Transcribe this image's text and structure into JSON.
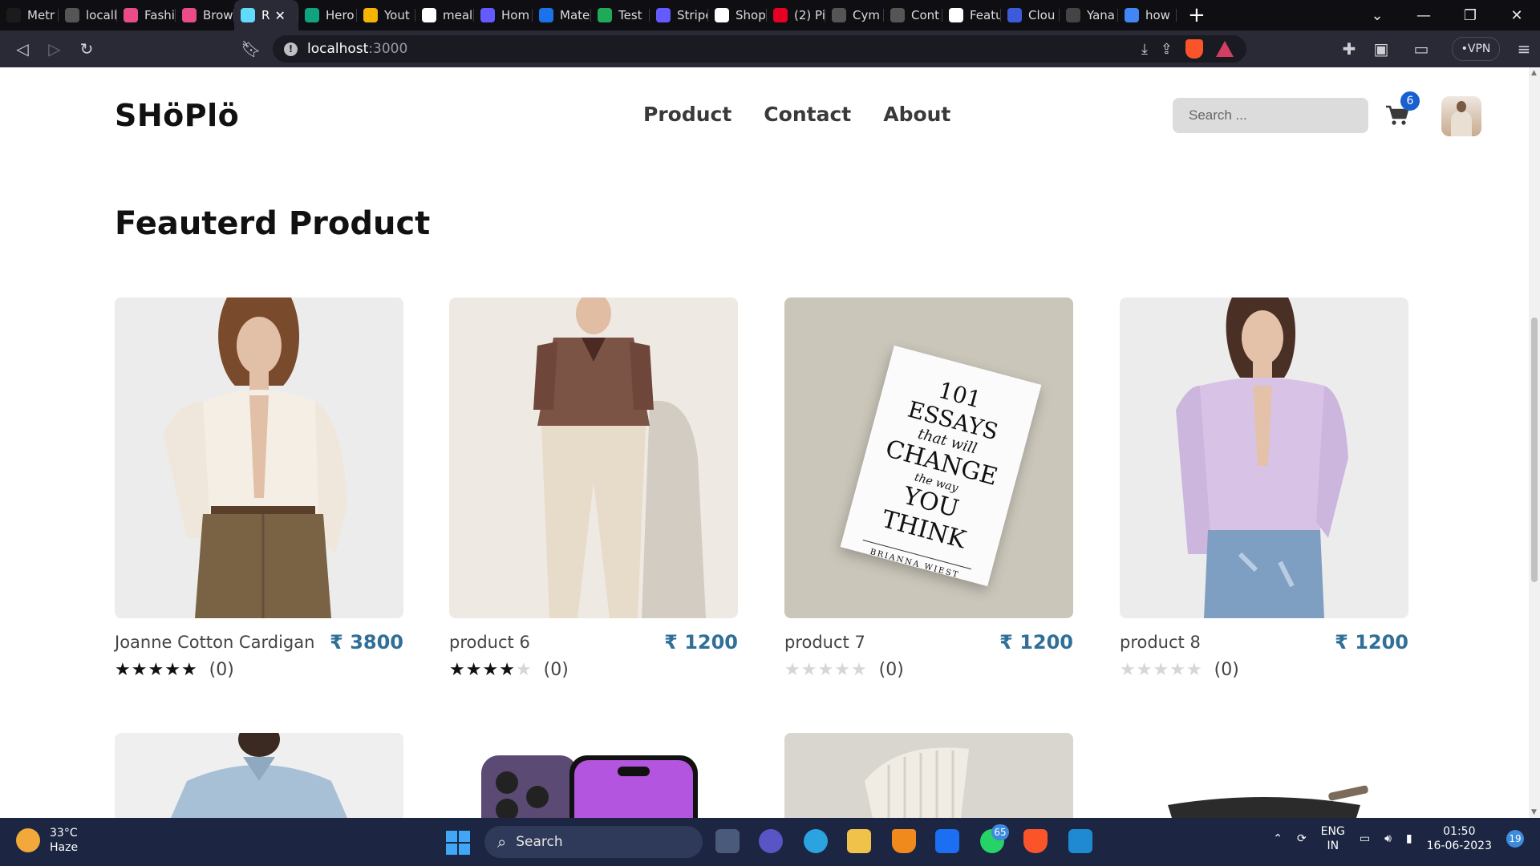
{
  "browser": {
    "tabs": [
      {
        "label": "Metr",
        "color": "#1b1b1b"
      },
      {
        "label": "locall",
        "color": "#555555"
      },
      {
        "label": "Fashi",
        "color": "#ea4c89"
      },
      {
        "label": "Brow",
        "color": "#ea4c89"
      },
      {
        "label": "R",
        "color": "#61dafb"
      },
      {
        "label": "Hero",
        "color": "#10a37f"
      },
      {
        "label": "Yout",
        "color": "#f6b400"
      },
      {
        "label": "meal",
        "color": "#ffffff"
      },
      {
        "label": "Hom",
        "color": "#635bff"
      },
      {
        "label": "Mate",
        "color": "#1a73e8"
      },
      {
        "label": "Test",
        "color": "#1faa59"
      },
      {
        "label": "Stripe",
        "color": "#635bff"
      },
      {
        "label": "Shop",
        "color": "#ffffff"
      },
      {
        "label": "(2) Pi",
        "color": "#e60023"
      },
      {
        "label": "Cym",
        "color": "#555555"
      },
      {
        "label": "Cont",
        "color": "#555555"
      },
      {
        "label": "Featu",
        "color": "#ffffff"
      },
      {
        "label": "Clou",
        "color": "#3b5bdb"
      },
      {
        "label": "Yana",
        "color": "#444444"
      },
      {
        "label": "how",
        "color": "#4285f4"
      }
    ],
    "active_tab_index": 4,
    "url_host": "localhost",
    "url_port": ":3000",
    "vpn_label": "VPN",
    "brand_color": "#fb542b"
  },
  "header": {
    "logo": "SHöPlö",
    "nav": [
      "Product",
      "Contact",
      "About"
    ],
    "search_placeholder": "Search ...",
    "cart_count": "6"
  },
  "section": {
    "title": "Feauterd Product"
  },
  "products": [
    {
      "name": "Joanne Cotton Cardigan",
      "price": "₹ 3800",
      "rating": 5,
      "rating_count": "(0)",
      "image": "woman-cream-cardigan"
    },
    {
      "name": "product 6",
      "price": "₹ 1200",
      "rating": 4,
      "rating_count": "(0)",
      "image": "man-patterned-polo"
    },
    {
      "name": "product 7",
      "price": "₹ 1200",
      "rating": 0,
      "rating_count": "(0)",
      "image": "book-101-essays"
    },
    {
      "name": "product 8",
      "price": "₹ 1200",
      "rating": 0,
      "rating_count": "(0)",
      "image": "woman-lilac-cardigan"
    }
  ],
  "book_cover": {
    "line1": "101",
    "line2": "ESSAYS",
    "line3": "that will",
    "line4": "CHANGE",
    "line5": "the way",
    "line6": "YOU",
    "line7": "THINK",
    "author": "BRIANNA WIEST"
  },
  "second_row_images": [
    "man-blue-shirt",
    "purple-iphone",
    "ribbed-vase",
    "black-pan"
  ],
  "taskbar": {
    "temperature": "33°C",
    "condition": "Haze",
    "search_label": "Search",
    "whatsapp_badge": "65",
    "lang_line1": "ENG",
    "lang_line2": "IN",
    "time": "01:50",
    "date": "16-06-2023",
    "notification_count": "19"
  }
}
